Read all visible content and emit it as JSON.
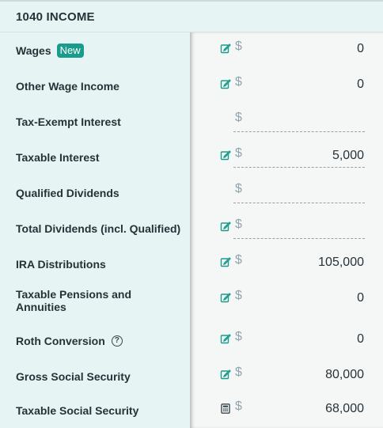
{
  "section": {
    "title": "1040 INCOME"
  },
  "rows": [
    {
      "label": "Wages",
      "badge": "New",
      "icon": "edit-icon",
      "currency": "$",
      "value": "0"
    },
    {
      "label": "Other Wage Income",
      "icon": "edit-icon",
      "currency": "$",
      "value": "0"
    },
    {
      "label": "Tax-Exempt Interest",
      "icon": "",
      "currency": "$",
      "value": ""
    },
    {
      "label": "Taxable Interest",
      "icon": "edit-icon",
      "currency": "$",
      "value": "5,000"
    },
    {
      "label": "Qualified Dividends",
      "icon": "",
      "currency": "$",
      "value": ""
    },
    {
      "label": "Total Dividends (incl. Qualified)",
      "icon": "edit-icon",
      "currency": "$",
      "value": ""
    },
    {
      "label": "IRA Distributions",
      "icon": "edit-icon",
      "currency": "$",
      "value": "105,000"
    },
    {
      "label": "Taxable Pensions and Annuities",
      "icon": "edit-icon",
      "currency": "$",
      "value": "0"
    },
    {
      "label": "Roth Conversion",
      "help_icon": "question-circle-icon",
      "icon": "edit-icon",
      "currency": "$",
      "value": "0"
    },
    {
      "label": "Gross Social Security",
      "icon": "edit-icon",
      "currency": "$",
      "value": "80,000"
    },
    {
      "label": "Taxable Social Security",
      "icon": "calculator-icon",
      "currency": "$",
      "value": "68,000"
    }
  ],
  "colors": {
    "accent": "#1a9c8c",
    "left_panel": "#e6f5f3",
    "right_panel": "#f5f7f7"
  }
}
